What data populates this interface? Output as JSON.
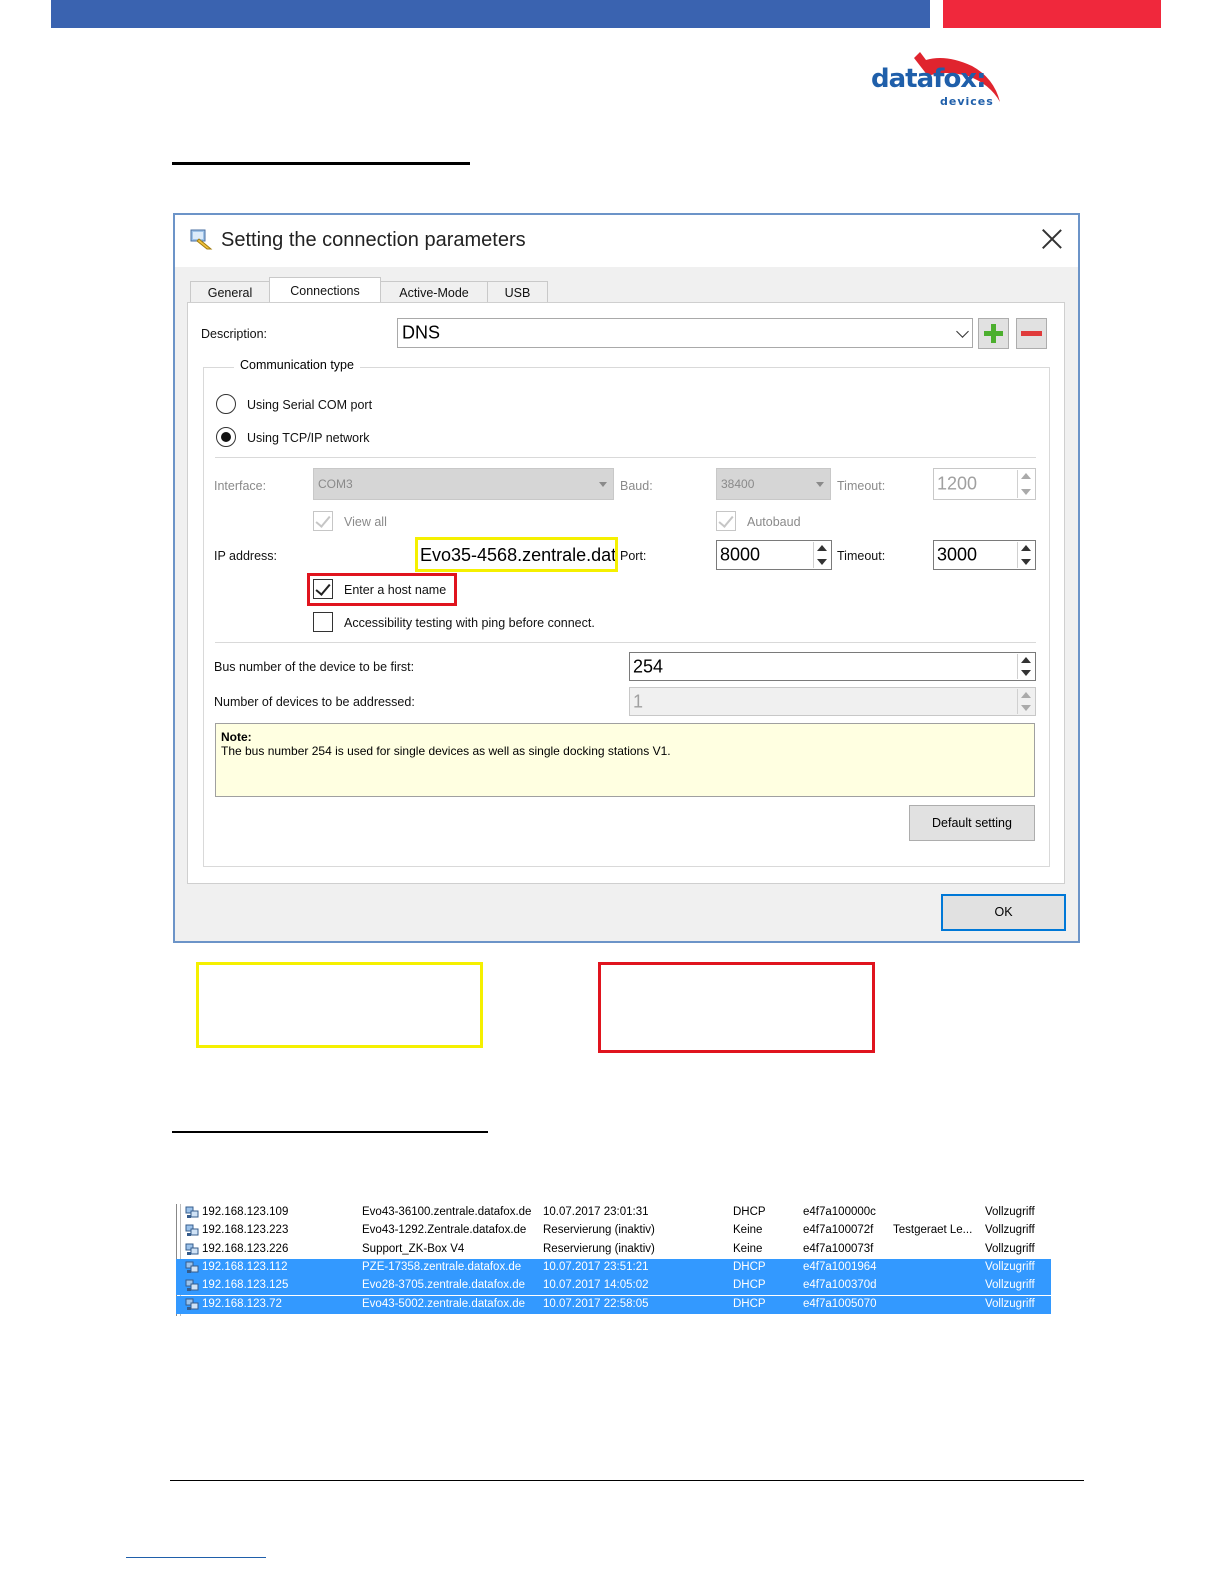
{
  "logo": {
    "text": "datafox:",
    "sub": "devices"
  },
  "dialog": {
    "title": "Setting the connection parameters",
    "tabs": [
      "General",
      "Connections",
      "Active-Mode",
      "USB"
    ],
    "description_label": "Description:",
    "description_value": "DNS",
    "comm_type_legend": "Communication type",
    "radio_serial": "Using Serial COM port",
    "radio_tcp": "Using TCP/IP network",
    "interface_label": "Interface:",
    "interface_value": "COM3",
    "baud_label": "Baud:",
    "baud_value": "38400",
    "timeout_label": "Timeout:",
    "timeout_serial_value": "1200",
    "view_all_label": "View all",
    "autobaud_label": "Autobaud",
    "ip_label": "IP address:",
    "ip_value": "Evo35-4568.zentrale.dat",
    "port_label": "Port:",
    "port_value": "8000",
    "timeout_tcp_value": "3000",
    "host_name_label": "Enter a host name",
    "ping_label": "Accessibility testing with ping before connect.",
    "bus_first_label": "Bus number of the device to be first:",
    "bus_first_value": "254",
    "num_devices_label": "Number of devices to be addressed:",
    "num_devices_value": "1",
    "note_title": "Note:",
    "note_text": "The bus number 254 is used for single devices as well as single docking stations V1.",
    "default_button": "Default setting",
    "ok_button": "OK"
  },
  "dhcp_table": {
    "rows": [
      {
        "ip": "192.168.123.109",
        "name": "Evo43-36100.zentrale.datafox.de",
        "lease": "10.07.2017 23:01:31",
        "type": "DHCP",
        "id": "e4f7a100000c",
        "desc": "",
        "access": "Vollzugriff",
        "selected": false
      },
      {
        "ip": "192.168.123.223",
        "name": "Evo43-1292.Zentrale.datafox.de",
        "lease": "Reservierung (inaktiv)",
        "type": "Keine",
        "id": "e4f7a100072f",
        "desc": "Testgeraet Le...",
        "access": "Vollzugriff",
        "selected": false
      },
      {
        "ip": "192.168.123.226",
        "name": "Support_ZK-Box V4",
        "lease": "Reservierung (inaktiv)",
        "type": "Keine",
        "id": "e4f7a100073f",
        "desc": "",
        "access": "Vollzugriff",
        "selected": false
      },
      {
        "ip": "192.168.123.112",
        "name": "PZE-17358.zentrale.datafox.de",
        "lease": "10.07.2017 23:51:21",
        "type": "DHCP",
        "id": "e4f7a1001964",
        "desc": "",
        "access": "Vollzugriff",
        "selected": true
      },
      {
        "ip": "192.168.123.125",
        "name": "Evo28-3705.zentrale.datafox.de",
        "lease": "10.07.2017 14:05:02",
        "type": "DHCP",
        "id": "e4f7a100370d",
        "desc": "",
        "access": "Vollzugriff",
        "selected": true
      },
      {
        "ip": "192.168.123.72",
        "name": "Evo43-5002.zentrale.datafox.de",
        "lease": "10.07.2017 22:58:05",
        "type": "DHCP",
        "id": "e4f7a1005070",
        "desc": "",
        "access": "Vollzugriff",
        "selected": true
      }
    ]
  },
  "colors": {
    "header_blue": "#3a63b0",
    "header_red": "#f0283c",
    "highlight_yellow": "#f5f000",
    "highlight_red": "#e0141e",
    "selection": "#3399ff"
  }
}
